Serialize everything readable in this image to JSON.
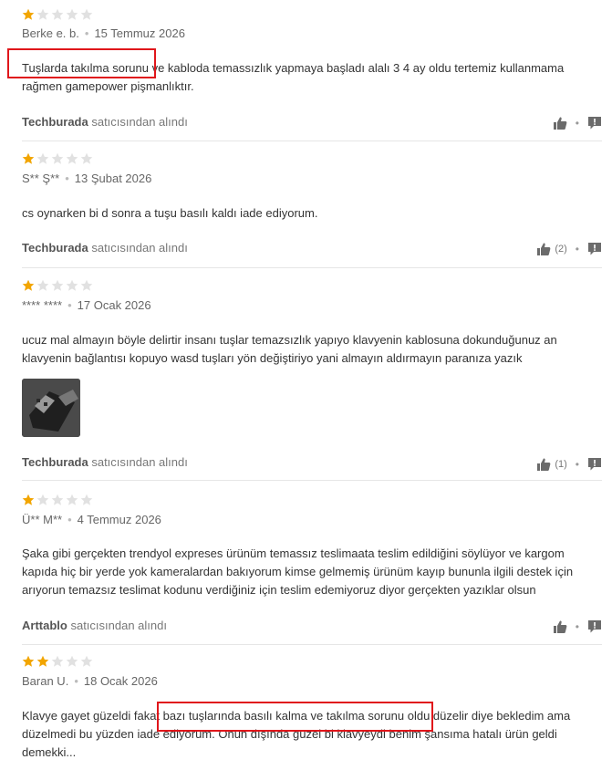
{
  "colors": {
    "star_filled": "#f2a500",
    "star_empty": "#e1e1e1",
    "highlight": "#e0161b",
    "icon": "#6b6b6b"
  },
  "seller_suffix": "satıcısından alındı",
  "reviews": [
    {
      "rating": 1,
      "author": "Berke e. b.",
      "date": "15 Temmuz 2026",
      "text": "Tuşlarda takılma sorunu ve kabloda temassızlık yapmaya başladı alalı 3 4 ay oldu tertemiz kullanmama rağmen gamepower pişmanlıktır.",
      "seller": "Techburada",
      "likes": ""
    },
    {
      "rating": 1,
      "author": "S** Ş**",
      "date": "13 Şubat 2026",
      "text": "cs oynarken bi d sonra a tuşu basılı kaldı iade ediyorum.",
      "seller": "Techburada",
      "likes": "(2)"
    },
    {
      "rating": 1,
      "author": "**** ****",
      "date": "17 Ocak 2026",
      "text": "ucuz mal almayın böyle delirtir insanı tuşlar temazsızlık yapıyo klavyenin kablosuna dokunduğunuz an klavyenin bağlantısı kopuyo wasd tuşları yön değiştiriyo yani almayın aldırmayın paranıza yazık",
      "seller": "Techburada",
      "likes": "(1)"
    },
    {
      "rating": 1,
      "author": "Ü** M**",
      "date": "4 Temmuz 2026",
      "text": "Şaka gibi gerçekten trendyol expreses ürünüm temassız teslimaata teslim edildiğini söylüyor ve kargom kapıda hiç bir yerde yok kameralardan bakıyorum kimse gelmemiş ürünüm kayıp bununla ilgili destek için arıyorun temazsız teslimat kodunu verdiğiniz için teslim edemiyoruz diyor gerçekten yazıklar olsun",
      "seller": "Arttablo",
      "likes": ""
    },
    {
      "rating": 2,
      "author": "Baran U.",
      "date": "18 Ocak 2026",
      "text": "Klavye gayet güzeldi fakat bazı tuşlarında basılı kalma ve takılma sorunu oldu düzelir diye bekledim ama düzelmedi bu yüzden iade ediyorum. Onun dışında güzel bi klavyeydi benim şansıma hatalı ürün geldi demekki...",
      "seller": "",
      "likes": ""
    }
  ]
}
